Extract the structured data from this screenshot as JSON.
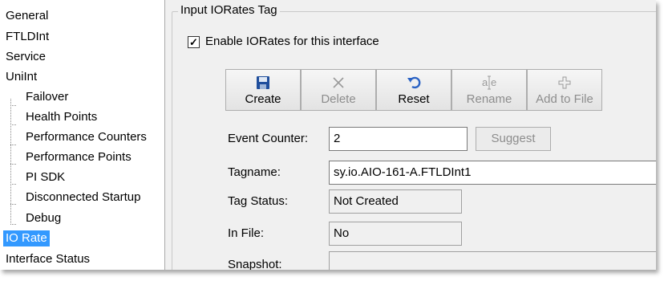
{
  "nav": {
    "items": [
      {
        "label": "General"
      },
      {
        "label": "FTLDInt"
      },
      {
        "label": "Service"
      },
      {
        "label": "UniInt"
      },
      {
        "label": "Failover"
      },
      {
        "label": "Health Points"
      },
      {
        "label": "Performance Counters"
      },
      {
        "label": "Performance Points"
      },
      {
        "label": "PI SDK"
      },
      {
        "label": "Disconnected Startup"
      },
      {
        "label": "Debug"
      },
      {
        "label": "IO Rate",
        "selected": true
      },
      {
        "label": "Interface Status"
      }
    ]
  },
  "group": {
    "title": "Input IORates Tag"
  },
  "enable": {
    "label": "Enable IORates for this interface",
    "checked": true
  },
  "toolbar": {
    "buttons": [
      {
        "label": "Create",
        "icon": "save-icon",
        "enabled": true
      },
      {
        "label": "Delete",
        "icon": "x-icon",
        "enabled": false
      },
      {
        "label": "Reset",
        "icon": "undo-icon",
        "enabled": true
      },
      {
        "label": "Rename",
        "icon": "rename-icon",
        "enabled": false
      },
      {
        "label": "Add to File",
        "icon": "add-file-icon",
        "enabled": false
      }
    ]
  },
  "fields": {
    "event_counter": {
      "label": "Event Counter:",
      "value": "2"
    },
    "suggest_label": "Suggest",
    "tagname": {
      "label": "Tagname:",
      "value": "sy.io.AIO-161-A.FTLDInt1"
    },
    "tag_status": {
      "label": "Tag Status:",
      "value": "Not Created"
    },
    "in_file": {
      "label": "In File:",
      "value": "No"
    },
    "snapshot": {
      "label": "Snapshot:",
      "value": ""
    }
  },
  "colors": {
    "selection": "#3399ff",
    "window_bg": "#f0f0f0"
  }
}
